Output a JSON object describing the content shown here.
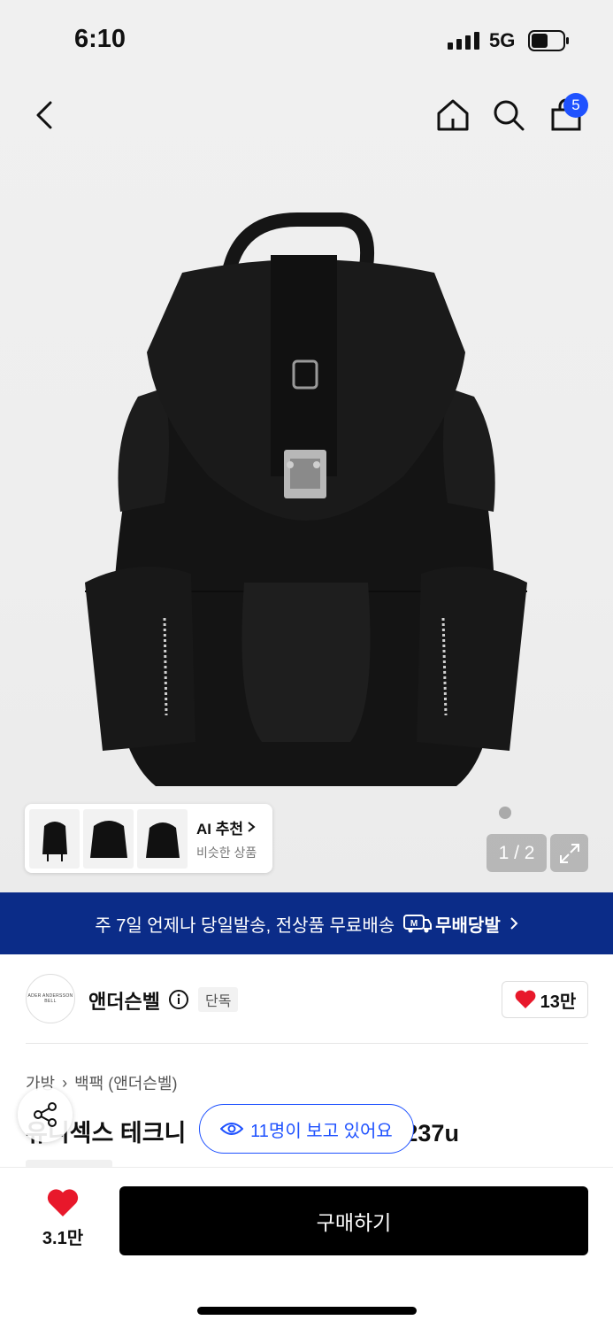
{
  "status_bar": {
    "time": "6:10",
    "network": "5G"
  },
  "nav": {
    "cart_count": "5"
  },
  "gallery": {
    "counter": "1 / 2"
  },
  "ai_recommend": {
    "title": "AI 추천",
    "subtitle": "비슷한 상품"
  },
  "banner": {
    "text": "주 7일 언제나 당일발송, 전상품 무료배송",
    "brand": "무배당발",
    "brand_mark": "M"
  },
  "brand": {
    "logo_text": "ADER ANDERSSON BELL",
    "name": "앤더슨벨",
    "badge": "단독",
    "likes": "13만"
  },
  "breadcrumb": {
    "items": [
      "가방",
      "백팩 (앤더슨벨)"
    ]
  },
  "product": {
    "title_visible_left": "유니섹스 테크니",
    "title_visible_right": "237u"
  },
  "viewers": {
    "text": "11명이 보고 있어요"
  },
  "bottom": {
    "favorites": "3.1만",
    "buy_label": "구매하기"
  },
  "colors": {
    "accent": "#1f52ff",
    "banner": "#0b2c88",
    "heart": "#e8182b"
  }
}
